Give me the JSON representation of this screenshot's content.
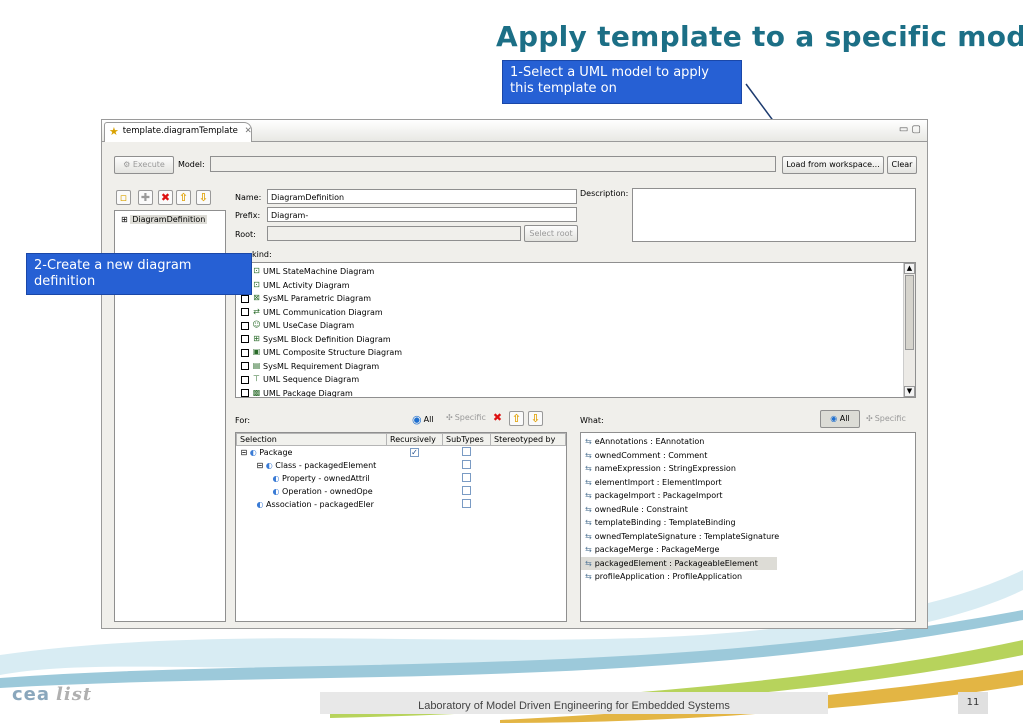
{
  "slide": {
    "title": "Apply template to a specific model",
    "callout1": "1-Select a UML model to apply this template on",
    "callout2": "2-Create a new diagram definition",
    "footer": "Laboratory of Model Driven Engineering for Embedded Systems",
    "page_number": "11",
    "logo_text": "cea",
    "logo_sub": "list"
  },
  "editor": {
    "tab_title": "template.diagramTemplate",
    "execute_label": "Execute",
    "model_label": "Model:",
    "model_value": "",
    "load_button": "Load from workspace...",
    "clear_button": "Clear",
    "tree_item": "DiagramDefinition",
    "name_label": "Name:",
    "name_value": "DiagramDefinition",
    "prefix_label": "Prefix:",
    "prefix_value": "Diagram-",
    "root_label": "Root:",
    "root_value": "",
    "select_root_label": "Select root",
    "description_label": "Description:",
    "description_value": "",
    "kind_label": "kind:",
    "diagram_kinds": [
      {
        "label": "UML StateMachine Diagram",
        "icon": "statemachine-icon"
      },
      {
        "label": "UML Activity Diagram",
        "icon": "activity-icon"
      },
      {
        "label": "SysML Parametric Diagram",
        "icon": "parametric-icon"
      },
      {
        "label": "UML Communication Diagram",
        "icon": "communication-icon"
      },
      {
        "label": "UML UseCase Diagram",
        "icon": "usecase-icon"
      },
      {
        "label": "SysML Block Definition Diagram",
        "icon": "block-icon"
      },
      {
        "label": "UML Composite Structure Diagram",
        "icon": "composite-icon"
      },
      {
        "label": "SysML Requirement Diagram",
        "icon": "requirement-icon"
      },
      {
        "label": "UML Sequence Diagram",
        "icon": "sequence-icon"
      },
      {
        "label": "UML Package Diagram",
        "icon": "package-icon"
      }
    ],
    "for_label": "For:",
    "all_label": "All",
    "specific_label": "Specific",
    "what_label": "What:",
    "what_all_label": "All",
    "what_specific_label": "Specific",
    "selection_columns": [
      "Selection",
      "Recursively",
      "SubTypes",
      "Stereotyped by"
    ],
    "selection_rows": [
      {
        "indent": 0,
        "expander": "⊟",
        "label": "Package",
        "recursively": true,
        "subtypes": false
      },
      {
        "indent": 1,
        "expander": "⊟",
        "label": "Class - packagedElement",
        "recursively": null,
        "subtypes": false
      },
      {
        "indent": 2,
        "expander": "",
        "label": "Property - ownedAttril",
        "recursively": null,
        "subtypes": false
      },
      {
        "indent": 2,
        "expander": "",
        "label": "Operation - ownedOpe",
        "recursively": null,
        "subtypes": false
      },
      {
        "indent": 1,
        "expander": "",
        "label": "Association - packagedEler",
        "recursively": null,
        "subtypes": false
      }
    ],
    "what_items": [
      {
        "label": "eAnnotations : EAnnotation",
        "selected": false
      },
      {
        "label": "ownedComment : Comment",
        "selected": false
      },
      {
        "label": "nameExpression : StringExpression",
        "selected": false
      },
      {
        "label": "elementImport : ElementImport",
        "selected": false
      },
      {
        "label": "packageImport : PackageImport",
        "selected": false
      },
      {
        "label": "ownedRule : Constraint",
        "selected": false
      },
      {
        "label": "templateBinding : TemplateBinding",
        "selected": false
      },
      {
        "label": "ownedTemplateSignature : TemplateSignature",
        "selected": false
      },
      {
        "label": "packageMerge : PackageMerge",
        "selected": false
      },
      {
        "label": "packagedElement : PackageableElement",
        "selected": true
      },
      {
        "label": "profileApplication : ProfileApplication",
        "selected": false
      }
    ]
  }
}
